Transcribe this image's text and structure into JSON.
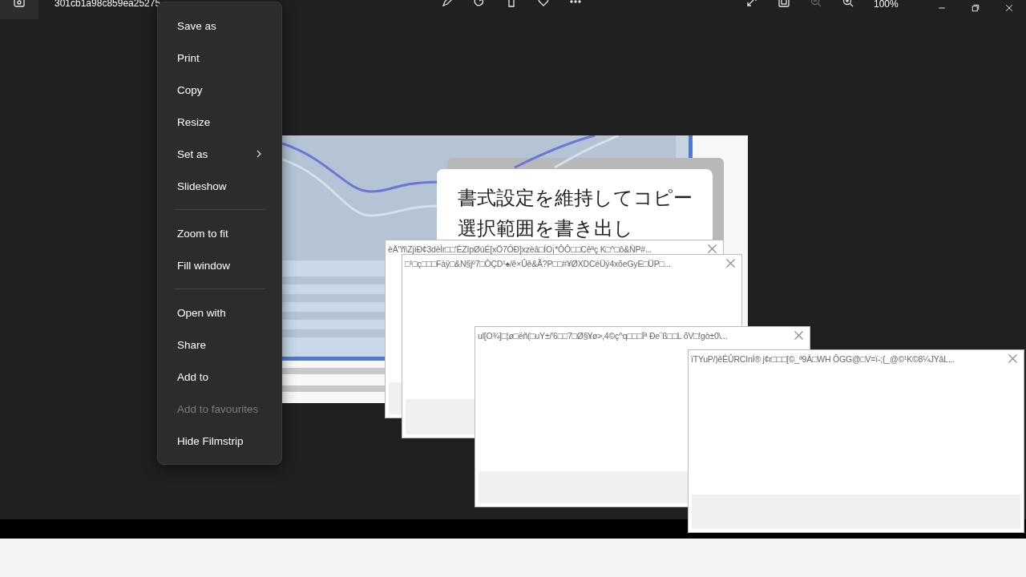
{
  "titlebar": {
    "file_name": "301cb1a98c859ea25275",
    "zoom": "100%"
  },
  "context_menu": {
    "items": [
      {
        "kind": "item",
        "label": "Save as",
        "disabled": false
      },
      {
        "kind": "item",
        "label": "Print",
        "disabled": false
      },
      {
        "kind": "item",
        "label": "Copy",
        "disabled": false
      },
      {
        "kind": "item",
        "label": "Resize",
        "disabled": false
      },
      {
        "kind": "submenu",
        "label": "Set as",
        "disabled": false
      },
      {
        "kind": "item",
        "label": "Slideshow",
        "disabled": false
      },
      {
        "kind": "separator"
      },
      {
        "kind": "item",
        "label": "Zoom to fit",
        "disabled": false
      },
      {
        "kind": "item",
        "label": "Fill window",
        "disabled": false
      },
      {
        "kind": "separator"
      },
      {
        "kind": "item",
        "label": "Open with",
        "disabled": false
      },
      {
        "kind": "item",
        "label": "Share",
        "disabled": false
      },
      {
        "kind": "item",
        "label": "Add to",
        "disabled": false
      },
      {
        "kind": "item",
        "label": "Add to favourites",
        "disabled": true
      },
      {
        "kind": "item",
        "label": "Hide Filmstrip",
        "disabled": false
      }
    ]
  },
  "image": {
    "lines": [
      "書式設定を維持してコピー",
      "選択範囲を書き出し"
    ]
  },
  "dialogs": [
    {
      "title": "èÄ\"ñ\\ZjìÐ¢3dèÌr□□'ÊZîpØúÉ[xÖ7ŐÐ]xzèâ□ÍO¡*ÔÔ□□Cêªç K□^□ô&ŇP#..."
    },
    {
      "title": "□¹□ç□□□Fàÿ□&N§jº7□ÒÇD¹♠/ê×Ûê&Ã?P□□#¥ØXDCéÜý4xõeGyE□ÜP□..."
    },
    {
      "title": "ul[O¾]□¦ø□ëñ(□uY±/'6□□7□Ø§¥ø>,4©ç^q□□□Ïª Ðe¨ß□□L õV□!gò±0\\..."
    },
    {
      "title": "ïTYuP/)êÊÛRCInÍ® j¢r□□□[©_ª9Â□WH  ÔGG@□V=ï-;{_@©¹K©8¼JYâL..."
    }
  ]
}
